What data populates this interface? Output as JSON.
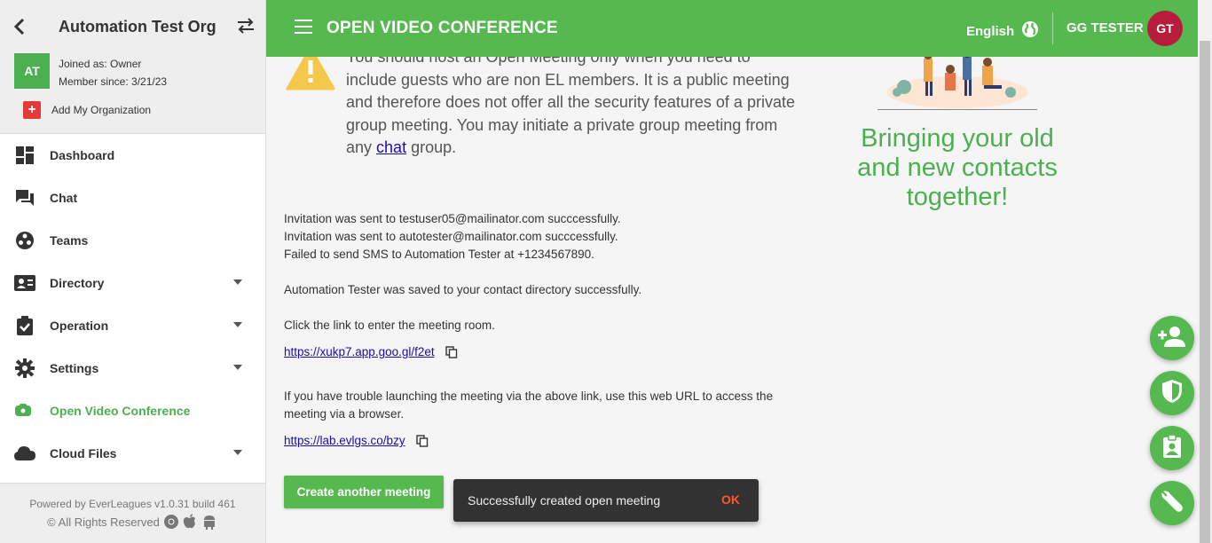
{
  "sidebar": {
    "org_name": "Automation Test Org",
    "org_initials": "AT",
    "joined_as": "Joined as: Owner",
    "member_since": "Member since: 3/21/23",
    "add_org_label": "Add My Organization",
    "items": [
      {
        "label": "Dashboard",
        "icon": "dashboard-icon"
      },
      {
        "label": "Chat",
        "icon": "chat-icon"
      },
      {
        "label": "Teams",
        "icon": "teams-icon"
      },
      {
        "label": "Directory",
        "icon": "directory-icon"
      },
      {
        "label": "Operation",
        "icon": "operation-icon"
      },
      {
        "label": "Settings",
        "icon": "settings-icon"
      },
      {
        "label": "Open Video Conference",
        "icon": "video-icon"
      },
      {
        "label": "Cloud Files",
        "icon": "cloud-icon"
      }
    ],
    "footer_line1": "Powered by EverLeagues v1.0.31 build 461",
    "footer_line2": "© All Rights Reserved"
  },
  "header": {
    "title": "OPEN VIDEO CONFERENCE",
    "language": "English",
    "user_name": "GG TESTER",
    "user_initials": "GT"
  },
  "main": {
    "warning_before_link": "You should host an Open Meeting only when you need to include guests who are non EL members. It is a public meeting and therefore does not offer all the security features of a private group meeting. You may initiate a private group meeting from any",
    "warning_link": "chat",
    "warning_after_link": "group.",
    "messages": [
      "Invitation was sent to testuser05@mailinator.com succcessfully.",
      "Invitation was sent to autotester@mailinator.com succcessfully.",
      "Failed to send SMS to Automation Tester at +1234567890."
    ],
    "saved_message": "Automation Tester was saved to your contact directory successfully.",
    "click_link_text": "Click the link to enter the meeting room.",
    "meeting_link": "https://xukp7.app.goo.gl/f2et",
    "trouble_text": "If you have trouble launching the meeting via the above link, use this web URL to access the meeting via a browser.",
    "web_link": "https://lab.evlgs.co/bzy",
    "create_button": "Create another meeting",
    "tagline": "Bringing your old and new contacts together!"
  },
  "toast": {
    "message": "Successfully created open meeting",
    "action": "OK"
  },
  "colors": {
    "brand_green": "#56b94f",
    "avatar_red": "#b71c3c",
    "toast_action": "#ff5722"
  }
}
